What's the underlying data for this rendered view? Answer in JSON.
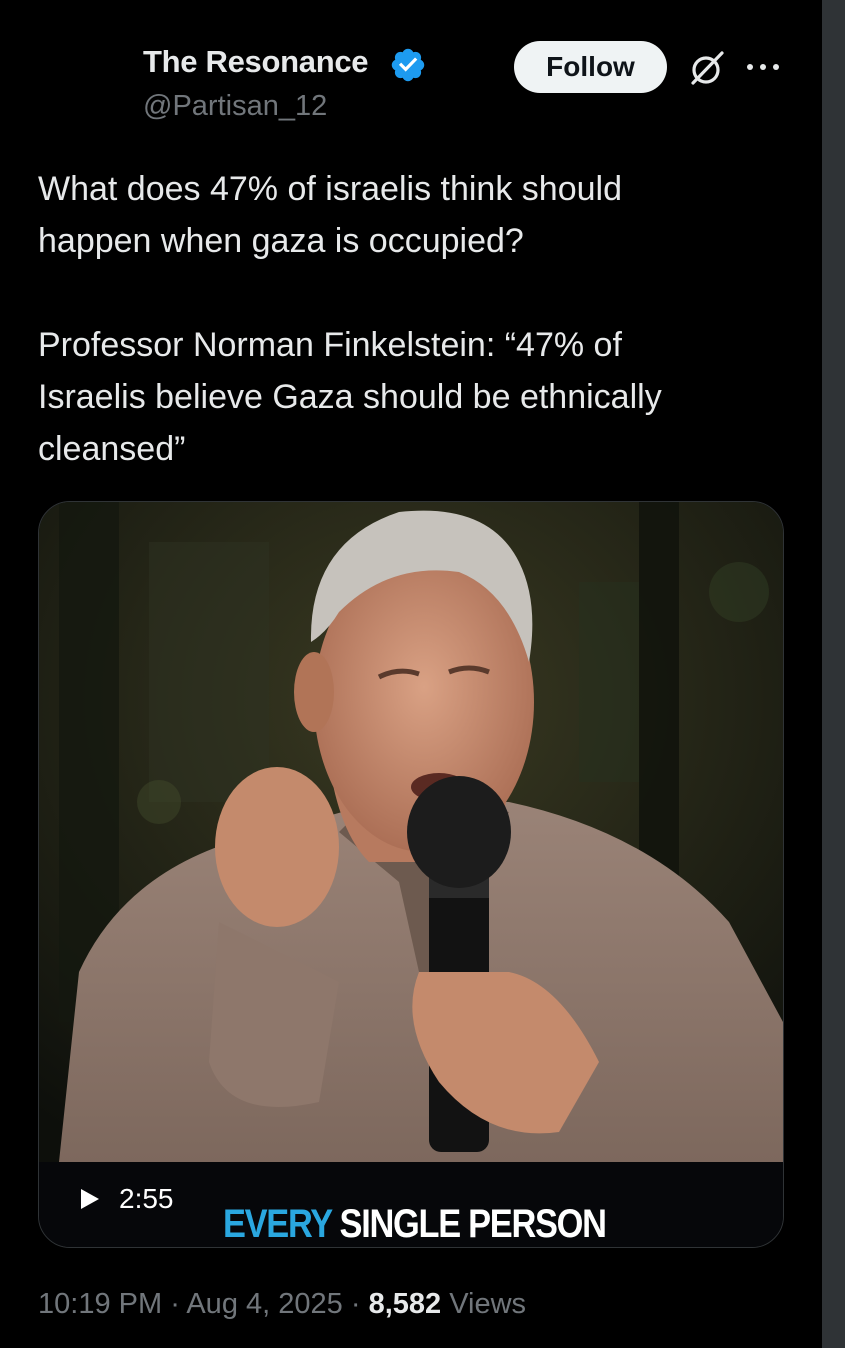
{
  "author": {
    "name": "The Resonance",
    "handle": "@Partisan_12",
    "verified": true,
    "verified_color": "#1d9bf0"
  },
  "actions": {
    "follow_label": "Follow",
    "grok_icon": "grok-icon",
    "more_icon": "more-icon"
  },
  "tweet": {
    "line1": "What does 47% of israelis think should",
    "line2": "happen when gaza is occupied?",
    "line3": "Professor Norman Finkelstein: “47% of",
    "line4": "Israelis believe Gaza should be ethnically",
    "line5": "cleansed”"
  },
  "media": {
    "duration": "2:55",
    "caption_highlight": "EVERY",
    "caption_rest": "SINGLE PERSON",
    "caption_highlight_color": "#2aa7e0"
  },
  "meta": {
    "time": "10:19 PM",
    "sep1": "·",
    "date": "Aug 4, 2025",
    "sep2": "·",
    "views_count": "8,582",
    "views_label": "Views"
  }
}
